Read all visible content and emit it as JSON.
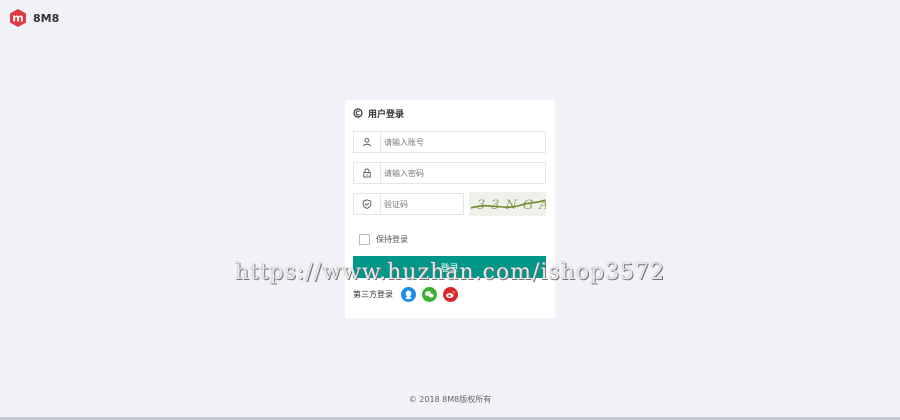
{
  "brand": {
    "name": "8M8",
    "logo_letter": "m",
    "logo_color": "#e0393e"
  },
  "login": {
    "title": "用户登录",
    "username_placeholder": "请输入账号",
    "password_placeholder": "请输入密码",
    "captcha_placeholder": "验证码",
    "captcha_text": "33NGA",
    "remember_label": "保持登录",
    "submit_label": "登录",
    "third_party_label": "第三方登录"
  },
  "icons": {
    "header": "circle-c-icon",
    "username": "user-icon",
    "password": "lock-icon",
    "captcha": "shield-check-icon",
    "qq": "qq-icon",
    "wechat": "wechat-icon",
    "weibo": "weibo-icon"
  },
  "colors": {
    "primary": "#009688",
    "qq": "#1e8ce8",
    "wechat": "#3cb034",
    "weibo": "#d8282c"
  },
  "watermark": "https://www.huzhan.com/ishop3572",
  "footer": "© 2018  8M8版权所有"
}
